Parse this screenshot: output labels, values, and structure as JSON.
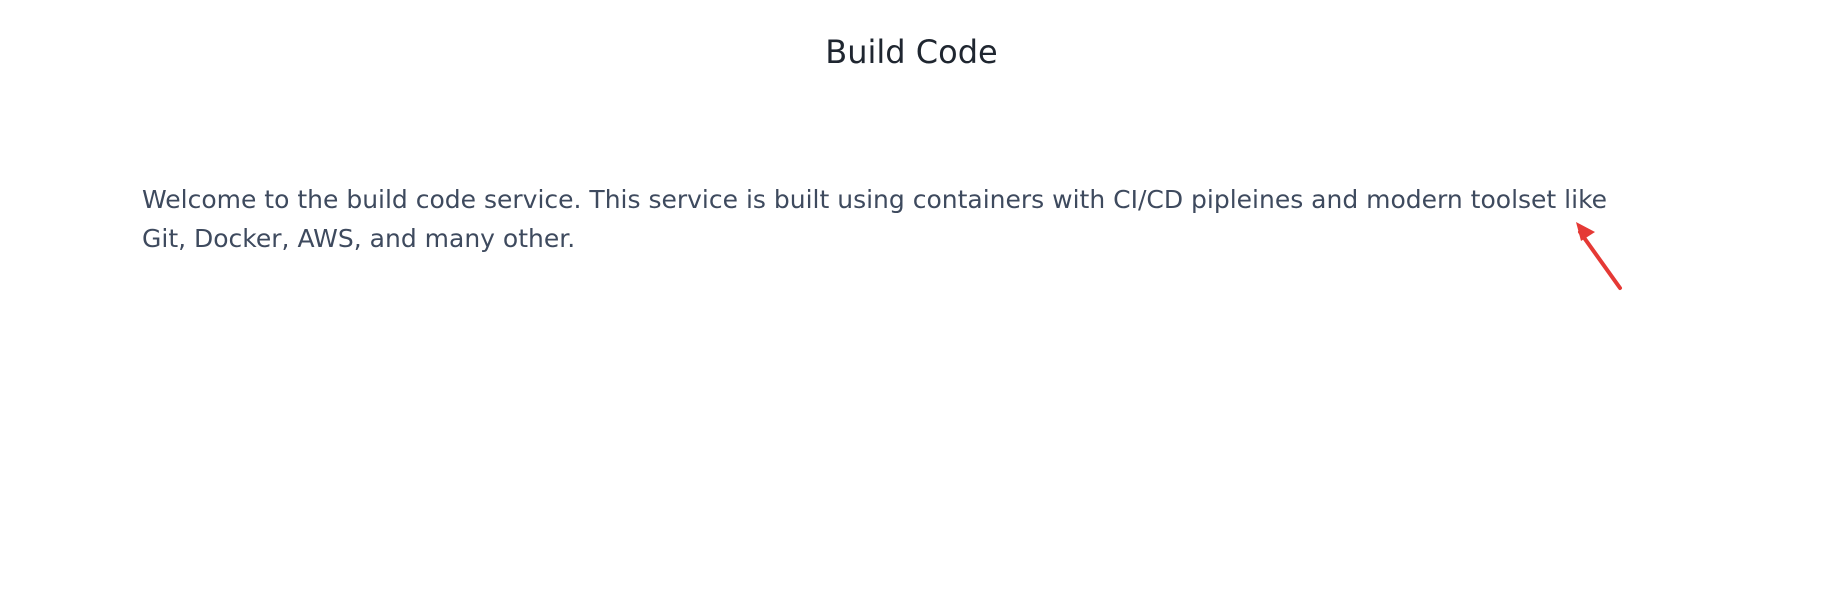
{
  "page": {
    "title": "Build Code",
    "description": "Welcome to the build code service. This service is built using containers with CI/CD pipleines and modern toolset like Git, Docker, AWS, and many other."
  },
  "annotation": {
    "icon": "red-arrow-icon",
    "color": "#e53935"
  }
}
